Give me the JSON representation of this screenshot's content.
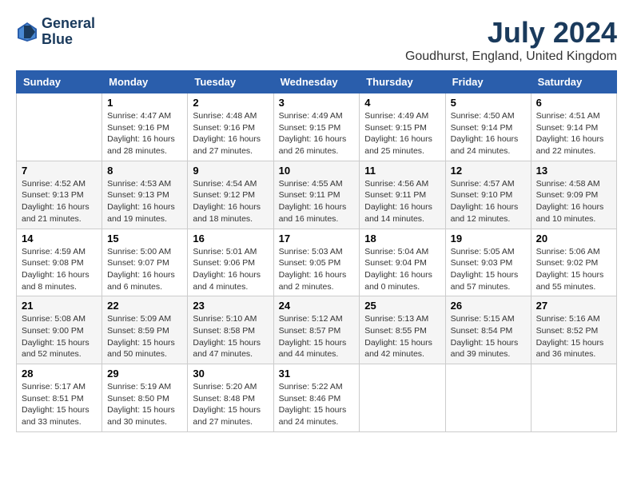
{
  "logo": {
    "line1": "General",
    "line2": "Blue"
  },
  "title": "July 2024",
  "location": "Goudhurst, England, United Kingdom",
  "days_of_week": [
    "Sunday",
    "Monday",
    "Tuesday",
    "Wednesday",
    "Thursday",
    "Friday",
    "Saturday"
  ],
  "weeks": [
    [
      {
        "day": "",
        "content": ""
      },
      {
        "day": "1",
        "content": "Sunrise: 4:47 AM\nSunset: 9:16 PM\nDaylight: 16 hours\nand 28 minutes."
      },
      {
        "day": "2",
        "content": "Sunrise: 4:48 AM\nSunset: 9:16 PM\nDaylight: 16 hours\nand 27 minutes."
      },
      {
        "day": "3",
        "content": "Sunrise: 4:49 AM\nSunset: 9:15 PM\nDaylight: 16 hours\nand 26 minutes."
      },
      {
        "day": "4",
        "content": "Sunrise: 4:49 AM\nSunset: 9:15 PM\nDaylight: 16 hours\nand 25 minutes."
      },
      {
        "day": "5",
        "content": "Sunrise: 4:50 AM\nSunset: 9:14 PM\nDaylight: 16 hours\nand 24 minutes."
      },
      {
        "day": "6",
        "content": "Sunrise: 4:51 AM\nSunset: 9:14 PM\nDaylight: 16 hours\nand 22 minutes."
      }
    ],
    [
      {
        "day": "7",
        "content": "Sunrise: 4:52 AM\nSunset: 9:13 PM\nDaylight: 16 hours\nand 21 minutes."
      },
      {
        "day": "8",
        "content": "Sunrise: 4:53 AM\nSunset: 9:13 PM\nDaylight: 16 hours\nand 19 minutes."
      },
      {
        "day": "9",
        "content": "Sunrise: 4:54 AM\nSunset: 9:12 PM\nDaylight: 16 hours\nand 18 minutes."
      },
      {
        "day": "10",
        "content": "Sunrise: 4:55 AM\nSunset: 9:11 PM\nDaylight: 16 hours\nand 16 minutes."
      },
      {
        "day": "11",
        "content": "Sunrise: 4:56 AM\nSunset: 9:11 PM\nDaylight: 16 hours\nand 14 minutes."
      },
      {
        "day": "12",
        "content": "Sunrise: 4:57 AM\nSunset: 9:10 PM\nDaylight: 16 hours\nand 12 minutes."
      },
      {
        "day": "13",
        "content": "Sunrise: 4:58 AM\nSunset: 9:09 PM\nDaylight: 16 hours\nand 10 minutes."
      }
    ],
    [
      {
        "day": "14",
        "content": "Sunrise: 4:59 AM\nSunset: 9:08 PM\nDaylight: 16 hours\nand 8 minutes."
      },
      {
        "day": "15",
        "content": "Sunrise: 5:00 AM\nSunset: 9:07 PM\nDaylight: 16 hours\nand 6 minutes."
      },
      {
        "day": "16",
        "content": "Sunrise: 5:01 AM\nSunset: 9:06 PM\nDaylight: 16 hours\nand 4 minutes."
      },
      {
        "day": "17",
        "content": "Sunrise: 5:03 AM\nSunset: 9:05 PM\nDaylight: 16 hours\nand 2 minutes."
      },
      {
        "day": "18",
        "content": "Sunrise: 5:04 AM\nSunset: 9:04 PM\nDaylight: 16 hours\nand 0 minutes."
      },
      {
        "day": "19",
        "content": "Sunrise: 5:05 AM\nSunset: 9:03 PM\nDaylight: 15 hours\nand 57 minutes."
      },
      {
        "day": "20",
        "content": "Sunrise: 5:06 AM\nSunset: 9:02 PM\nDaylight: 15 hours\nand 55 minutes."
      }
    ],
    [
      {
        "day": "21",
        "content": "Sunrise: 5:08 AM\nSunset: 9:00 PM\nDaylight: 15 hours\nand 52 minutes."
      },
      {
        "day": "22",
        "content": "Sunrise: 5:09 AM\nSunset: 8:59 PM\nDaylight: 15 hours\nand 50 minutes."
      },
      {
        "day": "23",
        "content": "Sunrise: 5:10 AM\nSunset: 8:58 PM\nDaylight: 15 hours\nand 47 minutes."
      },
      {
        "day": "24",
        "content": "Sunrise: 5:12 AM\nSunset: 8:57 PM\nDaylight: 15 hours\nand 44 minutes."
      },
      {
        "day": "25",
        "content": "Sunrise: 5:13 AM\nSunset: 8:55 PM\nDaylight: 15 hours\nand 42 minutes."
      },
      {
        "day": "26",
        "content": "Sunrise: 5:15 AM\nSunset: 8:54 PM\nDaylight: 15 hours\nand 39 minutes."
      },
      {
        "day": "27",
        "content": "Sunrise: 5:16 AM\nSunset: 8:52 PM\nDaylight: 15 hours\nand 36 minutes."
      }
    ],
    [
      {
        "day": "28",
        "content": "Sunrise: 5:17 AM\nSunset: 8:51 PM\nDaylight: 15 hours\nand 33 minutes."
      },
      {
        "day": "29",
        "content": "Sunrise: 5:19 AM\nSunset: 8:50 PM\nDaylight: 15 hours\nand 30 minutes."
      },
      {
        "day": "30",
        "content": "Sunrise: 5:20 AM\nSunset: 8:48 PM\nDaylight: 15 hours\nand 27 minutes."
      },
      {
        "day": "31",
        "content": "Sunrise: 5:22 AM\nSunset: 8:46 PM\nDaylight: 15 hours\nand 24 minutes."
      },
      {
        "day": "",
        "content": ""
      },
      {
        "day": "",
        "content": ""
      },
      {
        "day": "",
        "content": ""
      }
    ]
  ]
}
